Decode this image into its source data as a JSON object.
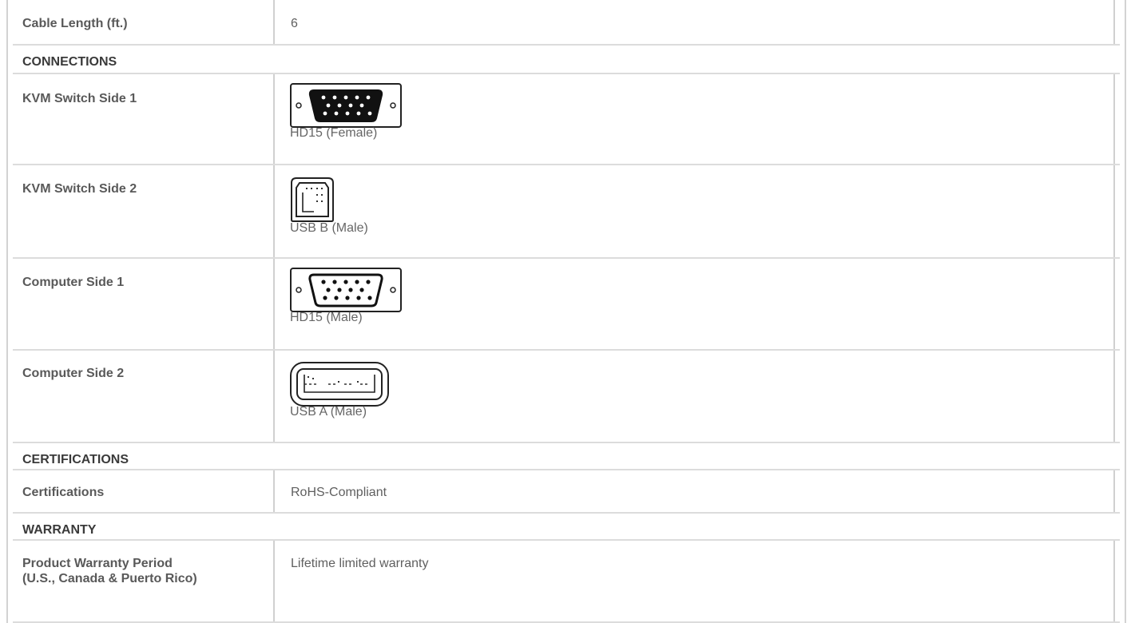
{
  "specs": {
    "cable_length": {
      "label": "Cable Length (ft.)",
      "value": "6"
    }
  },
  "sections": {
    "connections": "CONNECTIONS",
    "certifications": "CERTIFICATIONS",
    "warranty": "WARRANTY"
  },
  "connections": [
    {
      "label": "KVM Switch Side 1",
      "connector": "HD15 (Female)",
      "icon": "hd15-female-connector-icon"
    },
    {
      "label": "KVM Switch Side 2",
      "connector": "USB B (Male)",
      "icon": "usb-b-male-connector-icon"
    },
    {
      "label": "Computer Side 1",
      "connector": "HD15 (Male)",
      "icon": "hd15-male-connector-icon"
    },
    {
      "label": "Computer Side 2",
      "connector": "USB A (Male)",
      "icon": "usb-a-male-connector-icon"
    }
  ],
  "certifications": {
    "label": "Certifications",
    "value": "RoHS-Compliant"
  },
  "warranty": {
    "label_line1": "Product Warranty Period",
    "label_line2": "(U.S., Canada & Puerto Rico)",
    "value": "Lifetime limited warranty"
  }
}
